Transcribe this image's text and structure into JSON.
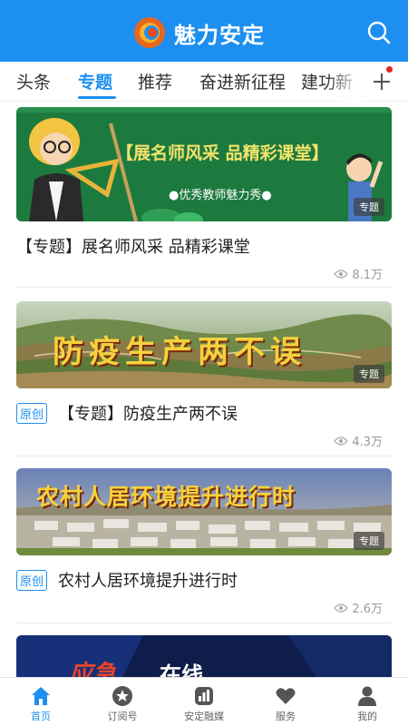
{
  "header": {
    "app_name": "魅力安定"
  },
  "tabs": [
    {
      "label": "头条"
    },
    {
      "label": "专题"
    },
    {
      "label": "推荐"
    },
    {
      "label": "奋进新征程"
    },
    {
      "label": "建功新"
    }
  ],
  "feed": [
    {
      "banner_text": "【展名师风采  品精彩课堂】",
      "banner_sub": "●优秀教师魅力秀●",
      "badge": "专题",
      "title": "【专题】展名师风采 品精彩课堂",
      "views": "8.1万"
    },
    {
      "banner_text": "防疫生产两不误",
      "badge": "专题",
      "tag": "原创",
      "title": "【专题】防疫生产两不误",
      "views": "4.3万"
    },
    {
      "banner_text": "农村人居环境提升进行时",
      "badge": "专题",
      "tag": "原创",
      "title": "农村人居环境提升进行时",
      "views": "2.6万"
    },
    {
      "banner_text_left": "应急",
      "banner_text_right": "在线"
    }
  ],
  "bottom_nav": [
    {
      "label": "首页",
      "icon": "home-icon"
    },
    {
      "label": "订阅号",
      "icon": "star-badge-icon"
    },
    {
      "label": "安定融媒",
      "icon": "media-icon"
    },
    {
      "label": "服务",
      "icon": "heart-icon"
    },
    {
      "label": "我的",
      "icon": "person-icon"
    }
  ],
  "colors": {
    "brand": "#1d8ff0",
    "chalkboard": "#1c7a3e",
    "dot": "#e42222"
  }
}
